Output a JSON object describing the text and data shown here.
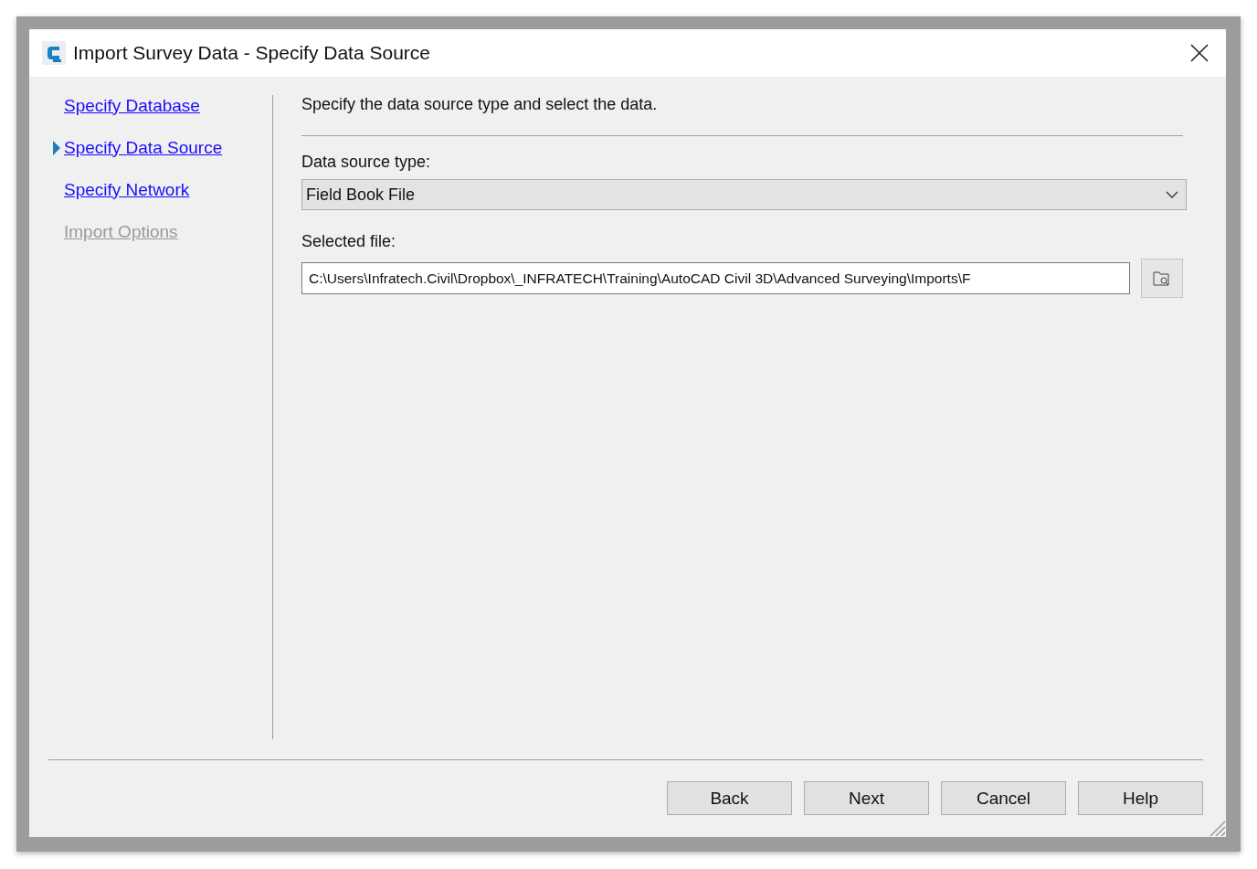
{
  "window": {
    "title": "Import Survey Data - Specify Data Source"
  },
  "steps": [
    {
      "label": "Specify Database",
      "selected": false,
      "disabled": false
    },
    {
      "label": "Specify Data Source",
      "selected": true,
      "disabled": false
    },
    {
      "label": "Specify Network",
      "selected": false,
      "disabled": false
    },
    {
      "label": "Import Options",
      "selected": false,
      "disabled": true
    }
  ],
  "instruction": "Specify the data source type and select the data.",
  "source_type": {
    "label": "Data source type:",
    "value": "Field Book File"
  },
  "selected_file": {
    "label": "Selected file:",
    "value": "C:\\Users\\Infratech.Civil\\Dropbox\\_INFRATECH\\Training\\AutoCAD Civil 3D\\Advanced Surveying\\Imports\\F"
  },
  "buttons": [
    "Back",
    "Next",
    "Cancel",
    "Help"
  ]
}
